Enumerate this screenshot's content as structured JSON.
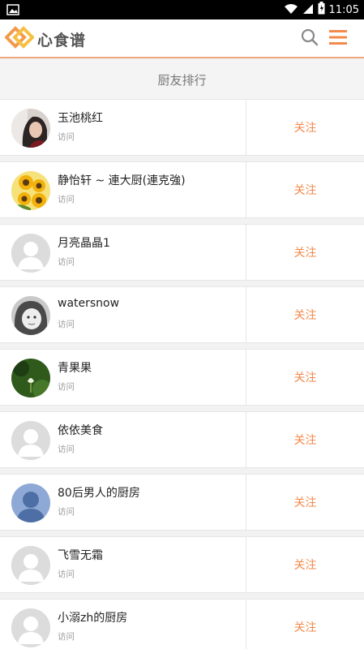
{
  "status_bar": {
    "time": "11:05"
  },
  "header": {
    "logo_text": "心食谱",
    "brand_color": "#f39a4a"
  },
  "page": {
    "title": "厨友排行"
  },
  "users": [
    {
      "name": "玉池桃红",
      "visit_label": "访问",
      "follow_label": "关注",
      "avatar": "photo-woman"
    },
    {
      "name": "静怡轩 ~ 連大厨(連克強)",
      "visit_label": "访问",
      "follow_label": "关注",
      "avatar": "sunflower"
    },
    {
      "name": "月亮晶晶1",
      "visit_label": "访问",
      "follow_label": "关注",
      "avatar": "default"
    },
    {
      "name": "watersnow",
      "visit_label": "访问",
      "follow_label": "关注",
      "avatar": "photo-child"
    },
    {
      "name": "青果果",
      "visit_label": "访问",
      "follow_label": "关注",
      "avatar": "green-flower"
    },
    {
      "name": "依依美食",
      "visit_label": "访问",
      "follow_label": "关注",
      "avatar": "default"
    },
    {
      "name": "80后男人的厨房",
      "visit_label": "访问",
      "follow_label": "关注",
      "avatar": "blue-silhouette"
    },
    {
      "name": "飞雪无霜",
      "visit_label": "访问",
      "follow_label": "关注",
      "avatar": "default"
    },
    {
      "name": "小溺zh的厨房",
      "visit_label": "访问",
      "follow_label": "关注",
      "avatar": "default"
    }
  ]
}
